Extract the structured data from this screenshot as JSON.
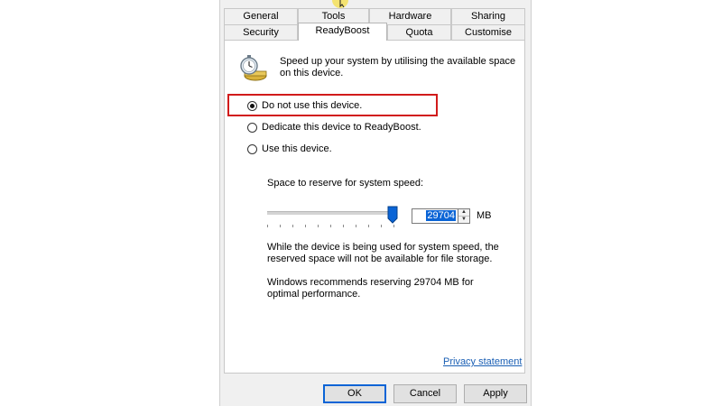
{
  "tabs_row1": [
    "General",
    "Tools",
    "Hardware",
    "Sharing"
  ],
  "tabs_row2": [
    "Security",
    "ReadyBoost",
    "Quota",
    "Customise"
  ],
  "active_tab": "ReadyBoost",
  "intro": {
    "icon": "readyboost-stopwatch-icon",
    "text": "Speed up your system by utilising the available space on this device."
  },
  "options": [
    {
      "label": "Do not use this device.",
      "checked": true
    },
    {
      "label": "Dedicate this device to ReadyBoost.",
      "checked": false
    },
    {
      "label": "Use this device.",
      "checked": false
    }
  ],
  "reserve": {
    "label": "Space to reserve for system speed:",
    "value": "29704",
    "unit": "MB",
    "slider_fraction": 1.0
  },
  "info_text": "While the device is being used for system speed, the reserved space will not be available for file storage.",
  "recommend_text": "Windows recommends reserving 29704 MB for optimal performance.",
  "privacy_link": "Privacy statement",
  "buttons": {
    "ok": "OK",
    "cancel": "Cancel",
    "apply": "Apply"
  },
  "colors": {
    "highlight": "#d11b1b",
    "selection": "#0a64d6",
    "link": "#1a5fb4"
  }
}
